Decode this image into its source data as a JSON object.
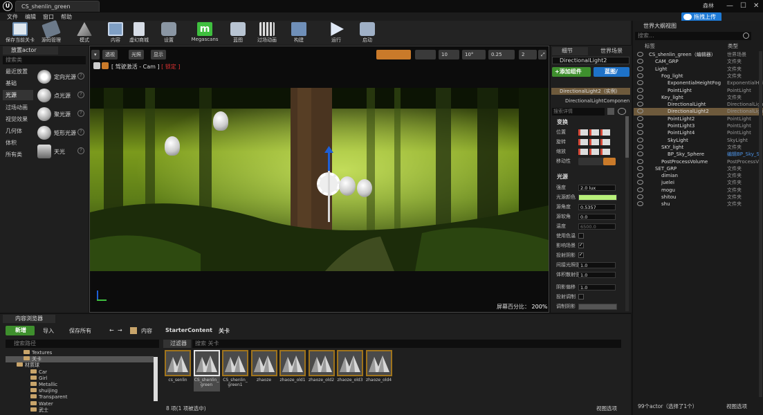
{
  "app": {
    "logo": "U",
    "doc_tab": "CS_shenlin_green",
    "user": "森林",
    "upload_button": "拖拽上传",
    "menu": [
      "文件",
      "编辑",
      "窗口",
      "帮助"
    ]
  },
  "toolbar": {
    "buttons": [
      {
        "label": "保存当前关卡",
        "icon": "save-icon"
      },
      {
        "label": "源码管理",
        "icon": "source-control-icon"
      },
      {
        "label": "模式",
        "icon": "modes-icon"
      },
      {
        "label": "内容",
        "icon": "content-icon"
      },
      {
        "label": "虚幻商城",
        "icon": "marketplace-icon"
      },
      {
        "label": "设置",
        "icon": "settings-icon"
      },
      {
        "label": "Megascans",
        "icon": "megascans-icon"
      },
      {
        "label": "蓝图",
        "icon": "blueprint-icon"
      },
      {
        "label": "过场动画",
        "icon": "cinematics-icon"
      },
      {
        "label": "构建",
        "icon": "build-icon"
      },
      {
        "label": "运行",
        "icon": "play-icon"
      },
      {
        "label": "启动",
        "icon": "launch-icon"
      }
    ]
  },
  "place_panel": {
    "tab": "放置actor",
    "search_placeholder": "搜索类",
    "categories": [
      "最近放置",
      "基础",
      "光源",
      "过场动画",
      "视觉效果",
      "几何体",
      "体积",
      "所有类"
    ],
    "selected_category": "光源",
    "items": [
      "定向光源",
      "点光源",
      "聚光源",
      "矩形光源",
      "天光"
    ]
  },
  "viewport": {
    "perspective": "透视",
    "lit": "光照",
    "show": "显示",
    "pilot_prefix": "[ 驾驶激活 - Cam ]",
    "pilot_lock": "[ 锁定 ]",
    "grid_snap": "10",
    "rot_snap": "10°",
    "scale_snap": "0.25",
    "cam_speed": "2",
    "screen_pct_label": "屏幕百分比：",
    "screen_pct": "200%"
  },
  "details": {
    "tabs": [
      "细节",
      "世界场景"
    ],
    "actor_name": "DirectionalLight2",
    "add_component": "+添加组件",
    "blueprint_button": "蓝图/",
    "instance_row": "DirectionalLight2（实例）",
    "component_row": "DirectionalLightComponen",
    "search_placeholder": "搜索详情",
    "transform_section": "变换",
    "transform_rows": [
      "位置",
      "旋转",
      "缩放",
      "移动性"
    ],
    "light_section": "光源",
    "light_rows": [
      {
        "label": "强度",
        "value": "2.0 lux"
      },
      {
        "label": "光源颜色",
        "value": ""
      },
      {
        "label": "源角度",
        "value": "0.5357"
      },
      {
        "label": "源软角",
        "value": "0.0"
      },
      {
        "label": "温度",
        "value": "6500.0"
      },
      {
        "label": "使用色温",
        "value": ""
      },
      {
        "label": "影响场景",
        "value": ""
      },
      {
        "label": "投射阴影",
        "value": ""
      },
      {
        "label": "间接光照强",
        "value": "1.0"
      },
      {
        "label": "体积散射强",
        "value": "1.0"
      },
      {
        "label": "阴影偏移",
        "value": "1.0"
      },
      {
        "label": "投射调制",
        "value": ""
      },
      {
        "label": "调制阴影",
        "value": ""
      }
    ],
    "light_color": "#b8f07a"
  },
  "outliner": {
    "tab": "世界大纲视图",
    "search_placeholder": "搜索...",
    "col_label": "标签",
    "col_type": "类型",
    "rows": [
      {
        "name": "CS_shenlin_green（编辑器）",
        "type": "世界场景",
        "indent": 0
      },
      {
        "name": "CAM_GRP",
        "type": "文件夹",
        "indent": 1
      },
      {
        "name": "Light",
        "type": "文件夹",
        "indent": 1
      },
      {
        "name": "Fog_light",
        "type": "文件夹",
        "indent": 2
      },
      {
        "name": "ExponentialHeightFog",
        "type": "ExponentialHeig",
        "indent": 3
      },
      {
        "name": "PointLight",
        "type": "PointLight",
        "indent": 3
      },
      {
        "name": "Key_light",
        "type": "文件夹",
        "indent": 2
      },
      {
        "name": "DirectionalLight",
        "type": "DirectionalLight",
        "indent": 3
      },
      {
        "name": "DirectionalLight2",
        "type": "DirectionalLight",
        "indent": 3,
        "selected": true
      },
      {
        "name": "PointLight2",
        "type": "PointLight",
        "indent": 3
      },
      {
        "name": "PointLight3",
        "type": "PointLight",
        "indent": 3
      },
      {
        "name": "PointLight4",
        "type": "PointLight",
        "indent": 3
      },
      {
        "name": "SkyLight",
        "type": "SkyLight",
        "indent": 3
      },
      {
        "name": "SKY_light",
        "type": "文件夹",
        "indent": 2
      },
      {
        "name": "BP_Sky_Sphere",
        "type": "编辑BP_Sky_S",
        "indent": 3,
        "link": true
      },
      {
        "name": "PostProcessVolume",
        "type": "PostProcessVol",
        "indent": 2
      },
      {
        "name": "SET_GRP",
        "type": "文件夹",
        "indent": 1
      },
      {
        "name": "dimian",
        "type": "文件夹",
        "indent": 2
      },
      {
        "name": "juelei",
        "type": "文件夹",
        "indent": 2
      },
      {
        "name": "mogu",
        "type": "文件夹",
        "indent": 2
      },
      {
        "name": "shitou",
        "type": "文件夹",
        "indent": 2
      },
      {
        "name": "shu",
        "type": "文件夹",
        "indent": 2
      }
    ],
    "footer": "99个actor（选择了1个）",
    "view_options": "视图选项"
  },
  "content_browser": {
    "tab": "内容浏览器",
    "new": "新增",
    "import": "导入",
    "save_all": "保存所有",
    "crumb_root": "内容",
    "crumb_1": "StarterContent",
    "crumb_2": "关卡",
    "path_search": "搜索路径",
    "filter": "过滤器",
    "asset_search": "搜索 关卡",
    "folders": [
      {
        "name": "Textures",
        "indent": 1
      },
      {
        "name": "关卡",
        "indent": 1,
        "selected": true
      },
      {
        "name": "材质球",
        "indent": 0
      },
      {
        "name": "Car",
        "indent": 2
      },
      {
        "name": "Girl",
        "indent": 2
      },
      {
        "name": "Metallic",
        "indent": 2
      },
      {
        "name": "shuijing",
        "indent": 2
      },
      {
        "name": "Transparent",
        "indent": 2
      },
      {
        "name": "Water",
        "indent": 2
      },
      {
        "name": "武士",
        "indent": 2
      }
    ],
    "assets": [
      "cs_senlin",
      "CS_shenlin_green",
      "CS_shenlin_green1",
      "zhaoze",
      "zhaoze_old1",
      "zhaoze_old2",
      "zhaoze_old3",
      "zhaoze_old4"
    ],
    "selected_asset": "CS_shenlin_green",
    "count": "8 项(1 项被选中)",
    "view_options": "视图选项"
  }
}
